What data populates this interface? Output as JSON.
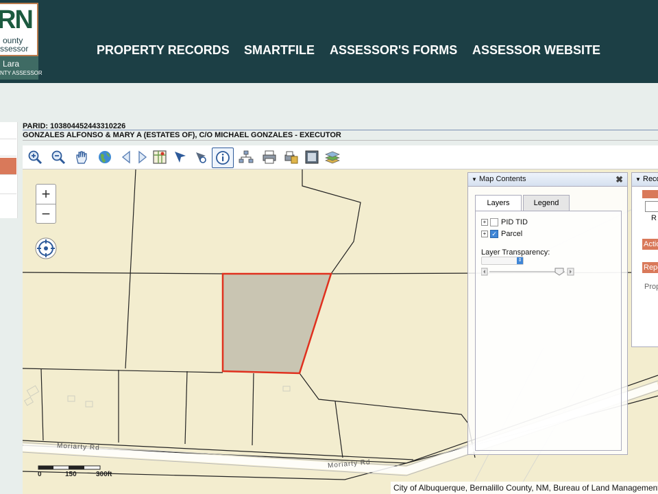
{
  "logo": {
    "big": "RN",
    "line1": "ounty",
    "line2": "ssessor",
    "name": "Lara",
    "sub": "NTY ASSESSOR"
  },
  "nav": [
    "PROPERTY RECORDS",
    "SMARTFILE",
    "ASSESSOR'S FORMS",
    "ASSESSOR WEBSITE"
  ],
  "parcel": {
    "parid": "PARID: 103804452443310226",
    "owner": "GONZALES ALFONSO & MARY A (ESTATES OF), C/O MICHAEL GONZALES - EXECUTOR"
  },
  "toolbar_icons": [
    "zoom-in-icon",
    "zoom-out-icon",
    "pan-hand-icon",
    "globe-icon",
    "back-arrow-icon",
    "forward-arrow-icon",
    "map-layers-icon",
    "select-arrow-icon",
    "select-point-icon",
    "info-icon",
    "network-icon",
    "print-icon",
    "print-preview-icon",
    "screen-icon",
    "stack-layers-icon"
  ],
  "map": {
    "zoom_in": "+",
    "zoom_out": "−",
    "road_label_1": "Moriarty Rd",
    "road_label_2": "Moriarty Rd",
    "scale": {
      "l0": "0",
      "l1": "150",
      "l2": "300ft"
    },
    "attribution": "City of Albuquerque, Bernalillo County, NM, Bureau of Land Management"
  },
  "map_contents": {
    "title": "Map Contents",
    "close": "✖",
    "tabs": [
      "Layers",
      "Legend"
    ],
    "layers": [
      {
        "name": "PID TID",
        "checked": false
      },
      {
        "name": "Parcel",
        "checked": true
      }
    ],
    "transparency_label": "Layer Transparency:"
  },
  "record_panel": {
    "title": "Reco",
    "r_text": "R",
    "action_btn": "Actio",
    "report_btn": "Repo",
    "prop_text": "Prop"
  },
  "colors": {
    "header": "#1c3f45",
    "parcel_outline": "#e0301e",
    "parcel_fill": "#c9c5b2",
    "accent": "#d9795a"
  }
}
